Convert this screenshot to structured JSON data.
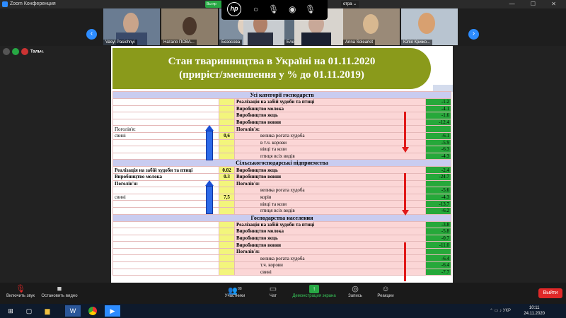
{
  "window": {
    "title": "Zoom Конференция",
    "controls": "— ☐ ✕"
  },
  "top_overlay": {
    "green_pill": "Вы пр",
    "view_label": "отра ⌄"
  },
  "participants": [
    {
      "name": "Vasyl Pasichnyi"
    },
    {
      "name": "Наталя ПОВА..."
    },
    {
      "name": "Безосова"
    },
    {
      "name": "Елена"
    },
    {
      "name": ""
    },
    {
      "name": "Anna Solearkit"
    },
    {
      "name": "Юлія Крижо..."
    }
  ],
  "share_label": "Тальч.",
  "slide": {
    "title_line1": "Стан тваринництва в Україні на 01.11.2020",
    "title_line2": "(приріст/зменшення у % до 01.11.2019)",
    "sections": [
      {
        "header": "Усі категорії господарств",
        "rows": [
          {
            "left": "",
            "mid": "",
            "right": "Реалізація на забій худоби та птиці",
            "val": "-1.2",
            "bold": true
          },
          {
            "left": "",
            "mid": "",
            "right": "Виробництво молока",
            "val": "-4.1",
            "bold": true
          },
          {
            "left": "",
            "mid": "",
            "right": "Виробництво яєць",
            "val": "-1.6",
            "bold": true
          },
          {
            "left": "",
            "mid": "",
            "right": "Виробництво вовни",
            "val": "-12.4",
            "bold": true
          },
          {
            "left": "Поголів'я:",
            "mid": "",
            "right": "Поголів'я:",
            "val": "",
            "bold": true
          },
          {
            "left": "свині",
            "mid": "0,6",
            "right": "велика рогата худоба",
            "val": "-6.1",
            "indent": true
          },
          {
            "left": "",
            "mid": "",
            "right": "в т.ч. корови",
            "val": "-5.9",
            "indent": true
          },
          {
            "left": "",
            "mid": "",
            "right": "вівці та кози",
            "val": "-6.3",
            "indent": true
          },
          {
            "left": "",
            "mid": "",
            "right": "птиця всіх видів",
            "val": "-4.3",
            "indent": true
          }
        ]
      },
      {
        "header": "Сільськогосподарські підприємства",
        "rows": [
          {
            "left": "Реалізація на забій худоби та птиці",
            "mid": "0.02",
            "right": "Виробництво яєць",
            "val": "-2.4",
            "bold": true,
            "leftbold": true
          },
          {
            "left": "Виробництво молока",
            "mid": "0.3",
            "right": "Виробництво вовни",
            "val": "-24.7",
            "bold": true,
            "leftbold": true
          },
          {
            "left": "Поголів'я:",
            "mid": "",
            "right": "Поголів'я:",
            "val": "",
            "bold": true,
            "leftbold": true
          },
          {
            "left": "",
            "mid": "",
            "right": "велика рогата худоба",
            "val": "-5.6",
            "indent": true
          },
          {
            "left": "свині",
            "mid": "7,5",
            "right": "корів",
            "val": "-4.3",
            "indent": true
          },
          {
            "left": "",
            "mid": "",
            "right": "вівці та кози",
            "val": "-13.7",
            "indent": true
          },
          {
            "left": "",
            "mid": "",
            "right": "птиця всіх видів",
            "val": "-6.2",
            "indent": true
          }
        ]
      },
      {
        "header": "Господарства населення",
        "rows": [
          {
            "left": "",
            "mid": "",
            "right": "Реалізація на забій худоби та птиці",
            "val": "-3.8",
            "bold": true
          },
          {
            "left": "",
            "mid": "",
            "right": "Виробництво молока",
            "val": "-5.8",
            "bold": true
          },
          {
            "left": "",
            "mid": "",
            "right": "Виробництво яєць",
            "val": "-0.7",
            "bold": true
          },
          {
            "left": "",
            "mid": "",
            "right": "Виробництво вовни",
            "val": "-11.0",
            "bold": true
          },
          {
            "left": "",
            "mid": "",
            "right": "Поголів'я:",
            "val": "",
            "bold": true
          },
          {
            "left": "",
            "mid": "",
            "right": "велика рогата худоба",
            "val": "-6.4",
            "indent": true
          },
          {
            "left": "",
            "mid": "",
            "right": "т.ч. корови",
            "val": "-6.4",
            "indent": true
          },
          {
            "left": "",
            "mid": "",
            "right": "свині",
            "val": "-7.7",
            "indent": true
          }
        ]
      }
    ]
  },
  "toolbar": {
    "mute": "Включить звук",
    "video": "Остановить видео",
    "participants": "Участники",
    "participants_count": "88",
    "chat": "Чат",
    "share": "Демонстрация экрана",
    "record": "Запись",
    "reactions": "Реакции",
    "leave": "Выйти"
  },
  "taskbar": {
    "time": "10:11",
    "date": "24.11.2020",
    "lang": "УКР"
  },
  "colors": {
    "zoom_blue": "#2d8cff",
    "slide_olive": "#8a9a1b",
    "value_green": "#26a83a",
    "leave_red": "#e02828"
  }
}
